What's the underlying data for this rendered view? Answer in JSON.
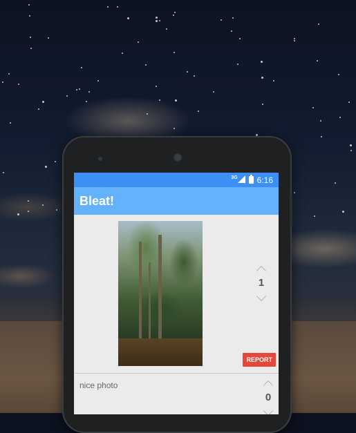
{
  "status_bar": {
    "network": "3G",
    "time": "6:16",
    "icons": [
      "signal-icon",
      "battery-icon"
    ]
  },
  "app_bar": {
    "title": "Bleat!"
  },
  "posts": [
    {
      "type": "image",
      "image_description": "photo of trees",
      "votes": "1",
      "report_label": "REPORT"
    },
    {
      "type": "text",
      "text": "nice photo",
      "votes": "0"
    }
  ],
  "colors": {
    "status_bar": "#3b8ff5",
    "app_bar": "#64b2fb",
    "report_button": "#e5473b",
    "list_background": "#ebebeb"
  }
}
